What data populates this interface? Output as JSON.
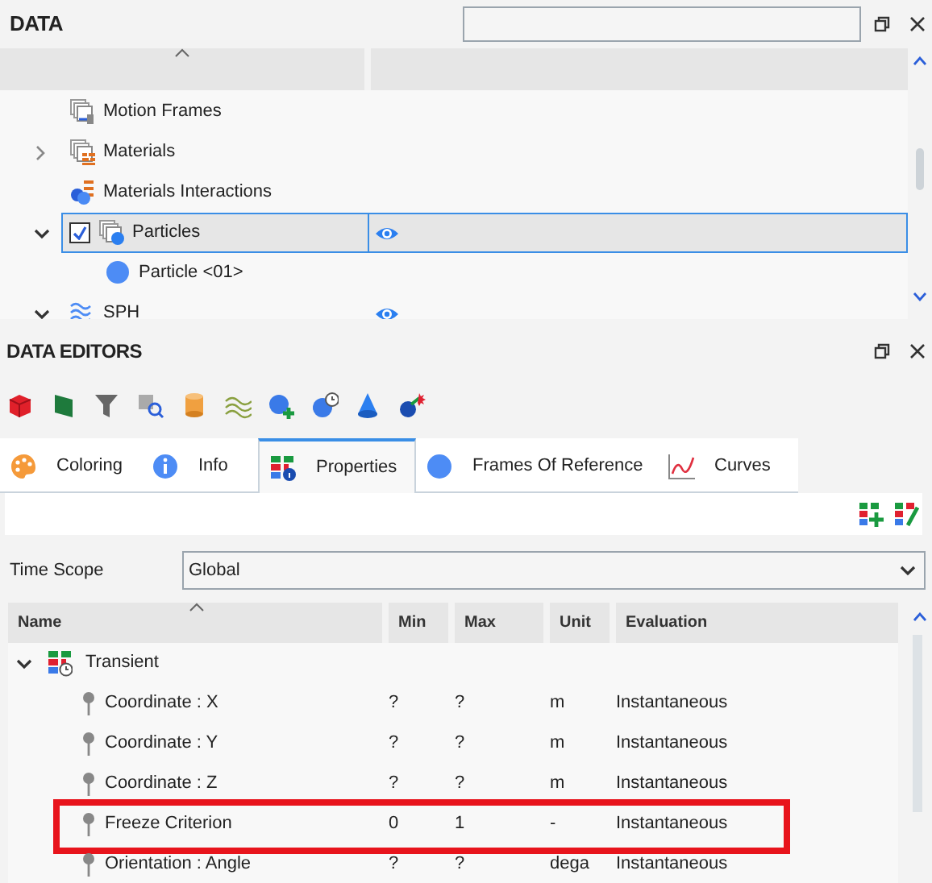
{
  "data_panel": {
    "title": "DATA",
    "tree": [
      {
        "label": "Motion Frames",
        "kind": "frames",
        "selected": false,
        "visible": false
      },
      {
        "label": "Materials",
        "kind": "materials",
        "expanded": false,
        "selected": false,
        "visible": false
      },
      {
        "label": "Materials Interactions",
        "kind": "interactions",
        "selected": false,
        "visible": false
      },
      {
        "label": "Particles",
        "kind": "particles",
        "expanded": true,
        "checked": true,
        "selected": true,
        "visible": true,
        "children": [
          {
            "label": "Particle <01>",
            "kind": "particle",
            "selected": false,
            "visible": false
          }
        ]
      },
      {
        "label": "SPH",
        "kind": "sph",
        "expanded": true,
        "selected": false,
        "visible": true
      }
    ]
  },
  "editors": {
    "title": "DATA EDITORS",
    "tabs": [
      {
        "label": "Coloring",
        "kind": "palette",
        "selected": false
      },
      {
        "label": "Info",
        "kind": "info",
        "selected": false
      },
      {
        "label": "Properties",
        "kind": "properties",
        "selected": true
      },
      {
        "label": "Frames Of Reference",
        "kind": "circle",
        "selected": false
      },
      {
        "label": "Curves",
        "kind": "curve",
        "selected": false
      }
    ],
    "time_scope": {
      "label": "Time Scope",
      "value": "Global"
    },
    "table": {
      "columns": [
        "Name",
        "Min",
        "Max",
        "Unit",
        "Evaluation"
      ],
      "groups": [
        {
          "label": "Transient",
          "expanded": true,
          "rows": [
            {
              "cells": [
                "Coordinate : X",
                "?",
                "?",
                "m",
                "Instantaneous"
              ],
              "highlighted": false
            },
            {
              "cells": [
                "Coordinate : Y",
                "?",
                "?",
                "m",
                "Instantaneous"
              ],
              "highlighted": false
            },
            {
              "cells": [
                "Coordinate : Z",
                "?",
                "?",
                "m",
                "Instantaneous"
              ],
              "highlighted": false
            },
            {
              "cells": [
                "Freeze Criterion",
                "0",
                "1",
                "-",
                "Instantaneous"
              ],
              "highlighted": true
            },
            {
              "cells": [
                "Orientation : Angle",
                "?",
                "?",
                "dega",
                "Instantaneous"
              ],
              "highlighted": false
            }
          ]
        }
      ]
    }
  }
}
